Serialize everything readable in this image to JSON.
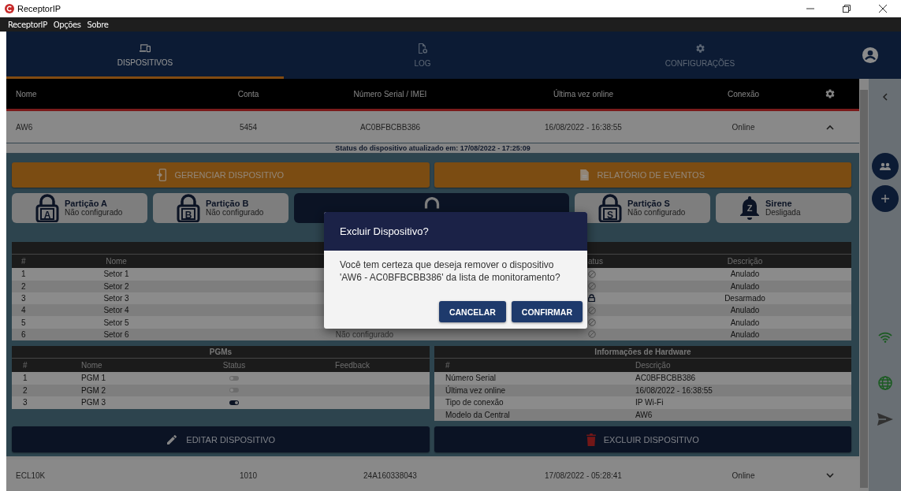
{
  "window": {
    "title": "ReceptorIP"
  },
  "menu": [
    {
      "label": "ReceptorIP"
    },
    {
      "label": "Opções"
    },
    {
      "label": "Sobre"
    }
  ],
  "tabs": [
    {
      "label": "DISPOSITIVOS",
      "selected": true
    },
    {
      "label": "LOG",
      "selected": false
    },
    {
      "label": "CONFIGURAÇÕES",
      "selected": false
    }
  ],
  "device_table": {
    "columns": [
      "Nome",
      "Conta",
      "Número Serial / IMEI",
      "Última vez online",
      "Conexão"
    ]
  },
  "devices": [
    {
      "name": "AW6",
      "account": "5454",
      "serial": "AC0BFBCBB386",
      "last_online": "16/08/2022 - 16:38:55",
      "connection": "Online",
      "expanded": true,
      "details": {
        "status_line": "Status do dispositivo atualizado em: 17/08/2022 - 17:25:09",
        "top_actions": [
          {
            "label": "GERENCIAR DISPOSITIVO"
          },
          {
            "label": "RELATÓRIO DE EVENTOS"
          }
        ],
        "partitions": [
          {
            "kind": "partition",
            "letter": "A",
            "title": "Partição A",
            "state": "Não configurado",
            "selected": false
          },
          {
            "kind": "partition",
            "letter": "B",
            "title": "Partição B",
            "state": "Não configurado",
            "selected": false
          },
          {
            "kind": "partition",
            "selected": true
          },
          {
            "kind": "partition",
            "letter": "S",
            "title": "Partição S",
            "state": "Não configurado",
            "selected": false
          },
          {
            "kind": "siren",
            "letter": "Z",
            "title": "Sirene",
            "state": "Desligada",
            "selected": false
          }
        ],
        "zones": {
          "header": {
            "number": "#",
            "name": "Nome",
            "status": "atus",
            "description": "Descrição"
          },
          "rows": [
            {
              "num": "1",
              "name": "Setor 1",
              "kind": "bypassed",
              "description": "Anulado"
            },
            {
              "num": "2",
              "name": "Setor 2",
              "kind": "bypassed",
              "description": "Anulado"
            },
            {
              "num": "3",
              "name": "Setor 3",
              "kind": "disarmed",
              "description": "Desarmado"
            },
            {
              "num": "4",
              "name": "Setor 4",
              "kind": "bypassed",
              "description": "Anulado"
            },
            {
              "num": "5",
              "name": "Setor 5",
              "kind": "bypassed",
              "description": "Anulado"
            },
            {
              "num": "6",
              "name": "Setor 6",
              "partition": "Não configurado",
              "kind": "bypassed",
              "description": "Anulado"
            }
          ]
        },
        "pgms": {
          "title": "PGMs",
          "header": {
            "number": "#",
            "name": "Nome",
            "status": "Status",
            "feedback": "Feedback"
          },
          "rows": [
            {
              "num": "1",
              "name": "PGM 1",
              "on": false
            },
            {
              "num": "2",
              "name": "PGM 2",
              "on": false
            },
            {
              "num": "3",
              "name": "PGM 3",
              "on": true
            }
          ]
        },
        "hardware": {
          "title": "Informações de Hardware",
          "header": {
            "number": "#",
            "description": "Descrição"
          },
          "rows": [
            {
              "label": "Número Serial",
              "value": "AC0BFBCBB386"
            },
            {
              "label": "Última vez online",
              "value": "16/08/2022 - 16:38:55"
            },
            {
              "label": "Tipo de conexão",
              "value": "IP Wi-Fi"
            },
            {
              "label": "Modelo da Central",
              "value": "AW6"
            }
          ]
        },
        "bottom_actions": [
          {
            "label": "EDITAR DISPOSITIVO"
          },
          {
            "label": "EXCLUIR DISPOSITIVO"
          }
        ]
      }
    },
    {
      "name": "ECL10K",
      "account": "1010",
      "serial": "24A160338043",
      "last_online": "17/08/2022 - 05:28:41",
      "connection": "Online",
      "expanded": false
    }
  ],
  "dialog": {
    "title": "Excluir Dispositivo?",
    "message": "Você tem certeza que deseja remover o dispositivo 'AW6 - AC0BFBCBB386' da lista de monitoramento?",
    "buttons": [
      "CANCELAR",
      "CONFIRMAR"
    ]
  }
}
